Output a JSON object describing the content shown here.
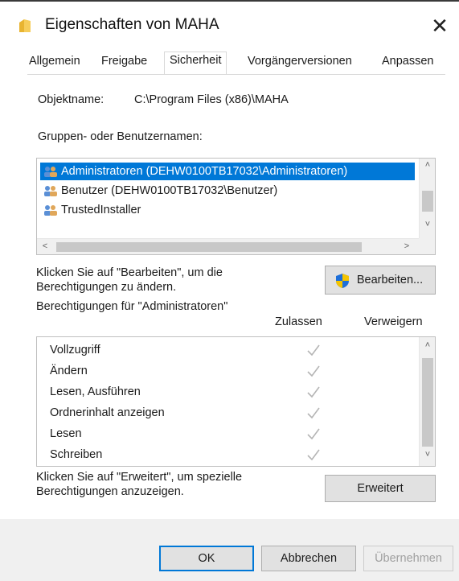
{
  "window": {
    "title": "Eigenschaften von MAHA",
    "close_symbol": "✕",
    "title_icon": "folder-icon"
  },
  "tabs": [
    {
      "label": "Allgemein",
      "active": false
    },
    {
      "label": "Freigabe",
      "active": false
    },
    {
      "label": "Sicherheit",
      "active": true
    },
    {
      "label": "Vorgängerversionen",
      "active": false
    },
    {
      "label": "Anpassen",
      "active": false
    }
  ],
  "security": {
    "object_label": "Objektname:",
    "object_value": "C:\\Program Files (x86)\\MAHA",
    "groups_label": "Gruppen- oder Benutzernamen:",
    "users": [
      {
        "name": "Administratoren (DEHW0100TB17032\\Administratoren)",
        "selected": true
      },
      {
        "name": "Benutzer (DEHW0100TB17032\\Benutzer)",
        "selected": false
      },
      {
        "name": "TrustedInstaller",
        "selected": false
      }
    ],
    "edit_hint": "Klicken Sie auf \"Bearbeiten\", um die Berechtigungen zu ändern.",
    "edit_hint_line1": "Klicken Sie auf \"Bearbeiten\", um die",
    "edit_hint_line2": "Berechtigungen zu ändern.",
    "edit_button": "Bearbeiten...",
    "perms_label": "Berechtigungen für \"Administratoren\"",
    "col_allow": "Zulassen",
    "col_deny": "Verweigern",
    "permissions": [
      {
        "name": "Vollzugriff",
        "allow": true,
        "deny": false
      },
      {
        "name": "Ändern",
        "allow": true,
        "deny": false
      },
      {
        "name": "Lesen, Ausführen",
        "allow": true,
        "deny": false
      },
      {
        "name": "Ordnerinhalt anzeigen",
        "allow": true,
        "deny": false
      },
      {
        "name": "Lesen",
        "allow": true,
        "deny": false
      },
      {
        "name": "Schreiben",
        "allow": true,
        "deny": false
      }
    ],
    "advanced_hint_line1": "Klicken Sie auf \"Erweitert\", um spezielle",
    "advanced_hint_line2": "Berechtigungen anzuzeigen.",
    "advanced_button": "Erweitert"
  },
  "footer": {
    "ok": "OK",
    "cancel": "Abbrechen",
    "apply": "Übernehmen"
  },
  "colors": {
    "selection": "#0078d7",
    "check": "#b5b5b5",
    "shield_blue": "#1e6fd9",
    "shield_yellow": "#f5c400"
  }
}
